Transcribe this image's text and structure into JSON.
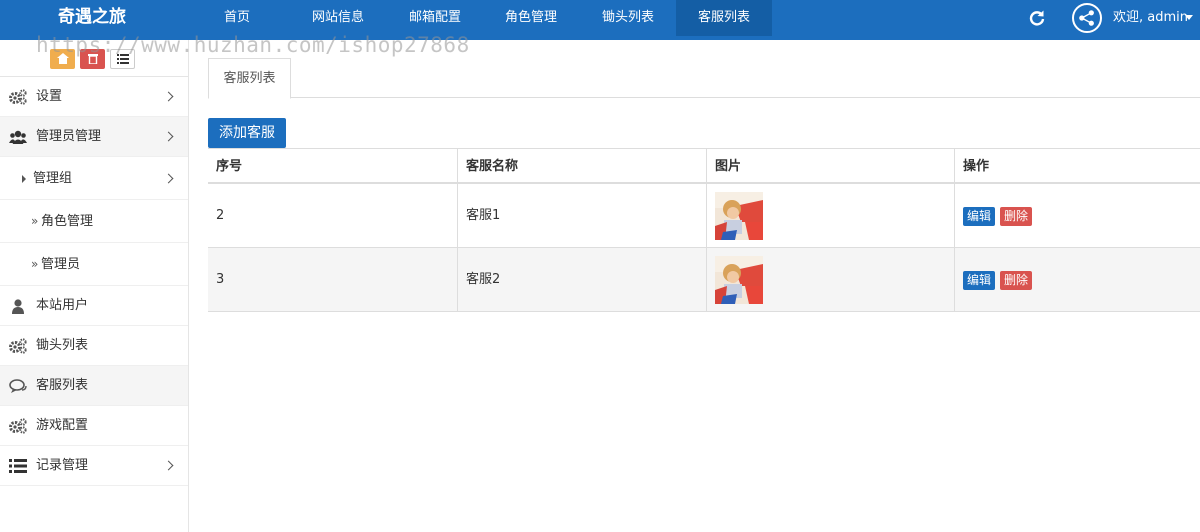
{
  "brand": "奇遇之旅",
  "nav": [
    "首页",
    "网站信息",
    "邮箱配置",
    "角色管理",
    "锄头列表",
    "客服列表"
  ],
  "user": {
    "welcome": "欢迎, admin"
  },
  "watermark": "https://www.huzhan.com/ishop27868",
  "sidebar": {
    "items": [
      {
        "label": "设置"
      },
      {
        "label": "管理员管理"
      },
      {
        "label": "管理组"
      },
      {
        "label": "角色管理"
      },
      {
        "label": "管理员"
      },
      {
        "label": "本站用户"
      },
      {
        "label": "锄头列表"
      },
      {
        "label": "客服列表"
      },
      {
        "label": "游戏配置"
      },
      {
        "label": "记录管理"
      }
    ]
  },
  "tab": "客服列表",
  "add_button": "添加客服",
  "table": {
    "headers": [
      "序号",
      "客服名称",
      "图片",
      "操作"
    ],
    "rows": [
      {
        "id": "2",
        "name": "客服1"
      },
      {
        "id": "3",
        "name": "客服2"
      }
    ],
    "edit_label": "编辑",
    "delete_label": "删除"
  },
  "colors": {
    "primary": "#1c6ebe",
    "danger": "#d9534f",
    "warning": "#f0ad4e"
  }
}
